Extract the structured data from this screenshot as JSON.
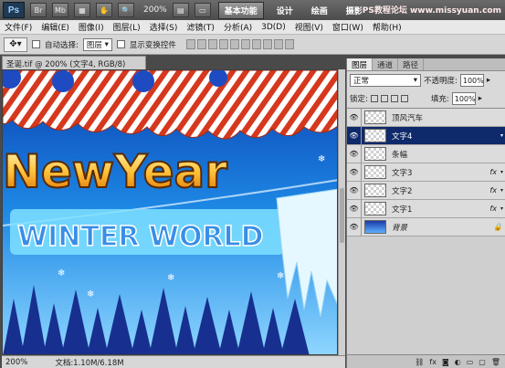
{
  "appbar": {
    "logo": "Ps",
    "zoom": "200%",
    "workspaces": [
      "基本功能",
      "设计",
      "绘画",
      "摄影"
    ],
    "active_workspace": 0,
    "watermark": "PS教程论坛 www.missyuan.com"
  },
  "menu": [
    "文件(F)",
    "编辑(E)",
    "图像(I)",
    "图层(L)",
    "选择(S)",
    "滤镜(T)",
    "分析(A)",
    "3D(D)",
    "视图(V)",
    "窗口(W)",
    "帮助(H)"
  ],
  "options": {
    "auto_select_label": "自动选择:",
    "auto_select_value": "图层",
    "show_transform_label": "显示变换控件"
  },
  "document": {
    "tab_title": "圣诞.tif @ 200% (文字4, RGB/8) *",
    "status_zoom": "200%",
    "status_doc": "文档:1.10M/6.18M",
    "artwork_line1": "NewYear",
    "artwork_line2": "WINTER WORLD"
  },
  "layers_panel": {
    "tabs": [
      "图层",
      "通道",
      "路径"
    ],
    "blend_mode": "正常",
    "opacity_label": "不透明度:",
    "opacity_value": "100%",
    "lock_label": "锁定:",
    "fill_label": "填充:",
    "fill_value": "100%",
    "layers": [
      {
        "name": "顶风汽车",
        "fx": false,
        "selected": false,
        "background": false
      },
      {
        "name": "文字4",
        "fx": false,
        "selected": true,
        "background": false
      },
      {
        "name": "条幅",
        "fx": false,
        "selected": false,
        "background": false
      },
      {
        "name": "文字3",
        "fx": true,
        "selected": false,
        "background": false
      },
      {
        "name": "文字2",
        "fx": true,
        "selected": false,
        "background": false
      },
      {
        "name": "文字1",
        "fx": true,
        "selected": false,
        "background": false
      },
      {
        "name": "背景",
        "fx": false,
        "selected": false,
        "background": true
      }
    ]
  }
}
